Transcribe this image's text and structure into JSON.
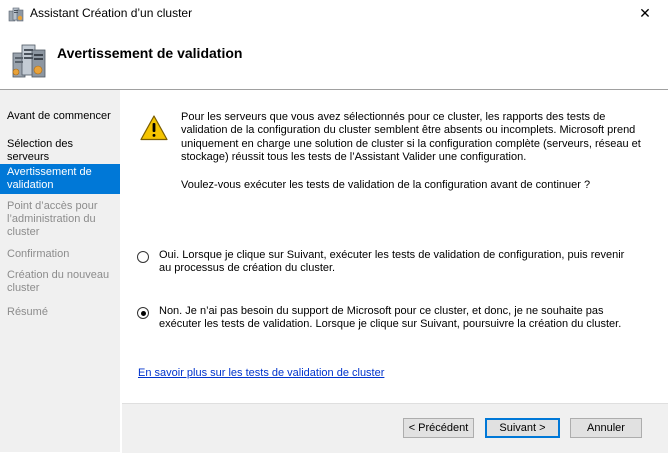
{
  "window": {
    "title": "Assistant Création d’un cluster",
    "close_glyph": "✕"
  },
  "header": {
    "title": "Avertissement de validation"
  },
  "sidebar": {
    "items": [
      {
        "label": "Avant de commencer",
        "state": "normal"
      },
      {
        "label": "Sélection des serveurs",
        "state": "normal"
      },
      {
        "label": "Avertissement de validation",
        "state": "active"
      },
      {
        "label": "Point d’accès pour l’administration du cluster",
        "state": "disabled"
      },
      {
        "label": "Confirmation",
        "state": "disabled"
      },
      {
        "label": "Création du nouveau cluster",
        "state": "disabled"
      },
      {
        "label": "Résumé",
        "state": "disabled"
      }
    ]
  },
  "main": {
    "warning_text": "Pour les serveurs que vous avez sélectionnés pour ce cluster, les rapports des tests de validation de la configuration du cluster semblent être absents ou incomplets. Microsoft prend uniquement en charge une solution de cluster si la configuration complète (serveurs, réseau et stockage) réussit tous les tests de l’Assistant Valider une configuration.",
    "question": "Voulez-vous exécuter les tests de validation de la configuration avant de continuer ?",
    "options": [
      {
        "label": "Oui. Lorsque je clique sur Suivant, exécuter les tests de validation de configuration, puis revenir au processus de création du cluster.",
        "checked": false
      },
      {
        "label": "Non. Je n’ai pas besoin du support de Microsoft pour ce cluster, et donc, je ne souhaite pas exécuter les tests de validation. Lorsque je clique sur Suivant, poursuivre la création du cluster.",
        "checked": true
      }
    ],
    "learn_more_link": "En savoir plus sur les tests de validation de cluster"
  },
  "footer": {
    "prev_label": "< Précédent",
    "next_label": "Suivant >",
    "cancel_label": "Annuler"
  },
  "colors": {
    "accent": "#0078d7",
    "sidebar_bg": "#f0f0f0",
    "link": "#0033cc",
    "warning_yellow": "#f5c400"
  },
  "icons": {
    "window": "cluster-server-icon",
    "header": "cluster-server-large-icon",
    "warning": "warning-triangle-icon"
  }
}
